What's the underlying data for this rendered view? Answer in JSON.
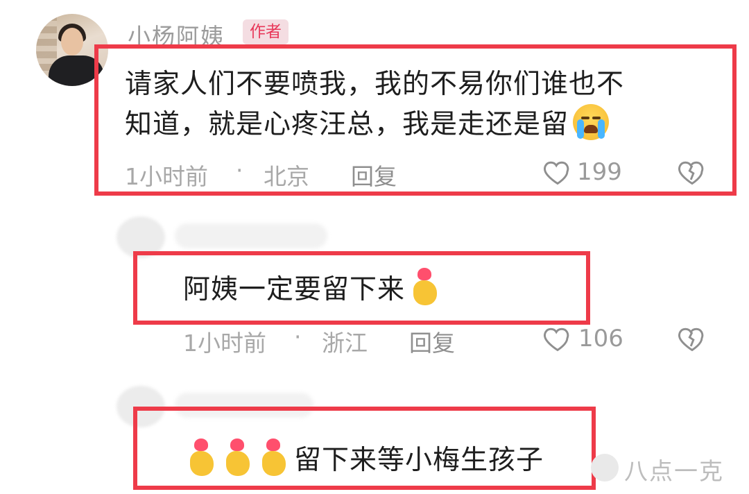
{
  "comment_main": {
    "author": "小杨阿姨",
    "badge": "作者",
    "line1": "请家人们不要喷我，我的不易你们谁也不",
    "line2": "知道，就是心疼汪总，我是走还是留",
    "emoji": "crying-face-icon",
    "time": "1小时前",
    "location": "北京",
    "reply_label": "回复",
    "likes": "199"
  },
  "reply_1": {
    "text": "阿姨一定要留下来",
    "emoji": "heart-hands-icon",
    "time": "1小时前",
    "location": "浙江",
    "reply_label": "回复",
    "likes": "106"
  },
  "reply_2": {
    "text": "留下来等小梅生孩子",
    "emoji": "heart-hands-icon"
  },
  "watermark": "八点一克",
  "colors": {
    "highlight_border": "#ee3b49",
    "badge_bg": "#f4dde2",
    "badge_text": "#e8385a",
    "meta_text": "#a8a8a8"
  }
}
